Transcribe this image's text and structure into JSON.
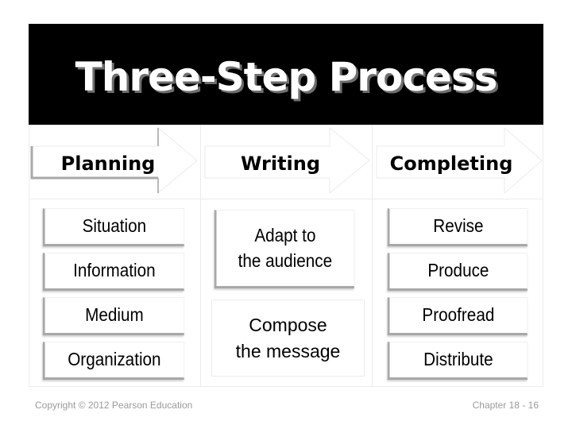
{
  "slide": {
    "title": "Three-Step Process",
    "steps": [
      {
        "label": "Planning",
        "tasks": [
          "Situation",
          "Information",
          "Medium",
          "Organization"
        ]
      },
      {
        "label": "Writing",
        "tasks": [
          "Adapt to the audience",
          "Compose the message"
        ],
        "tasks_lines": [
          [
            "Adapt to",
            "the audience"
          ],
          [
            "Compose",
            "the message"
          ]
        ]
      },
      {
        "label": "Completing",
        "tasks": [
          "Revise",
          "Produce",
          "Proofread",
          "Distribute"
        ]
      }
    ],
    "footer": {
      "copyright": "Copyright © 2012 Pearson Education",
      "page": "Chapter 18 -  16"
    }
  },
  "colors": {
    "title_band": "#000000",
    "title_text": "#ffffff",
    "title_shadow": "#6e6e6e",
    "footer_text": "#9a9a9a",
    "grid_line": "#ececec"
  }
}
